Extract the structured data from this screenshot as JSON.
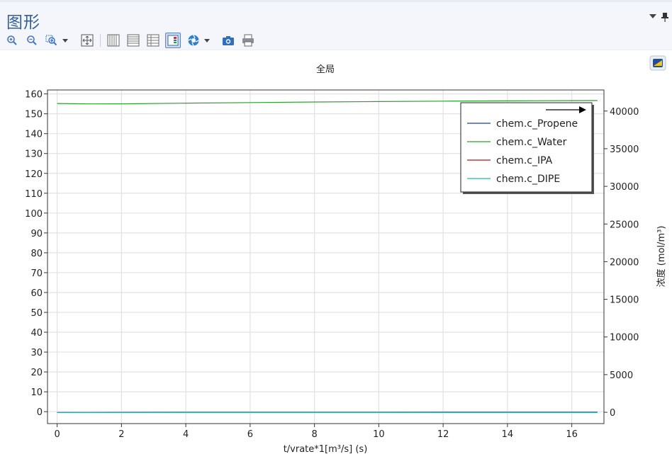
{
  "panel": {
    "title": "图形",
    "menu_icon": "dropdown-triangle-icon",
    "pin_icon": "pin-icon"
  },
  "toolbar": {
    "buttons": [
      {
        "name": "zoom-in-button",
        "icon": "zoom-in-icon"
      },
      {
        "name": "zoom-out-button",
        "icon": "zoom-out-icon"
      },
      {
        "name": "zoom-box-button",
        "icon": "zoom-box-icon"
      },
      {
        "name": "zoom-extents-button",
        "icon": "zoom-extents-icon"
      },
      {
        "name": "x-grid-button",
        "icon": "vertical-grid-icon"
      },
      {
        "name": "y-grid-button",
        "icon": "horizontal-grid-icon"
      },
      {
        "name": "xy-grid-button",
        "icon": "table-grid-icon"
      },
      {
        "name": "legend-toggle-button",
        "icon": "legend-icon",
        "active": true
      },
      {
        "name": "scene-light-button",
        "icon": "aperture-icon"
      },
      {
        "name": "snapshot-button",
        "icon": "camera-icon"
      },
      {
        "name": "print-button",
        "icon": "printer-icon"
      }
    ]
  },
  "side_icon": "color-table-icon",
  "colors": {
    "accent": "#2f5f9e",
    "propene": "#1f3fa0",
    "water": "#2ca02c",
    "ipa": "#b01919",
    "dipe": "#1fb8b8",
    "grid": "#e2e2e2"
  },
  "chart_data": {
    "type": "line",
    "title": "全局",
    "xlabel": "t/vrate*1[m³/s] (s)",
    "ylabel_left": "",
    "ylabel_right": "浓度 (mol/m³)",
    "xlim": [
      -0.3,
      17.0
    ],
    "ylim_left": [
      -6,
      162
    ],
    "ylim_right": [
      -1500,
      42800
    ],
    "x_ticks": [
      "0",
      "2",
      "4",
      "6",
      "8",
      "10",
      "12",
      "14",
      "16"
    ],
    "y_ticks_left": [
      "0",
      "10",
      "20",
      "30",
      "40",
      "50",
      "60",
      "70",
      "80",
      "90",
      "100",
      "110",
      "120",
      "130",
      "140",
      "150",
      "160"
    ],
    "y_ticks_right": [
      "0",
      "5000",
      "10000",
      "15000",
      "20000",
      "25000",
      "30000",
      "35000",
      "40000"
    ],
    "grid": true,
    "legend_position": "top-right",
    "legend_arrow": true,
    "series": [
      {
        "name": "chem.c_Propene",
        "axis": "right",
        "x": [
          0,
          2,
          4,
          6,
          8,
          10,
          12,
          14,
          16,
          16.8
        ],
        "values": [
          0,
          0,
          0,
          0,
          0,
          0,
          0,
          0,
          0,
          0
        ]
      },
      {
        "name": "chem.c_Water",
        "axis": "right",
        "x": [
          0,
          1,
          2,
          4,
          6,
          8,
          10,
          12,
          14,
          16,
          16.8
        ],
        "values": [
          41000,
          40950,
          40960,
          41050,
          41130,
          41200,
          41260,
          41310,
          41350,
          41390,
          41400
        ]
      },
      {
        "name": "chem.c_IPA",
        "axis": "right",
        "x": [
          0,
          2,
          4,
          6,
          8,
          10,
          12,
          14,
          16,
          16.8
        ],
        "values": [
          0,
          8,
          15,
          20,
          24,
          27,
          29,
          31,
          33,
          34
        ]
      },
      {
        "name": "chem.c_DIPE",
        "axis": "right",
        "x": [
          0,
          2,
          4,
          6,
          8,
          10,
          12,
          14,
          16,
          16.8
        ],
        "values": [
          0,
          0,
          0,
          0,
          0,
          0,
          0,
          0,
          0,
          0
        ]
      }
    ]
  }
}
